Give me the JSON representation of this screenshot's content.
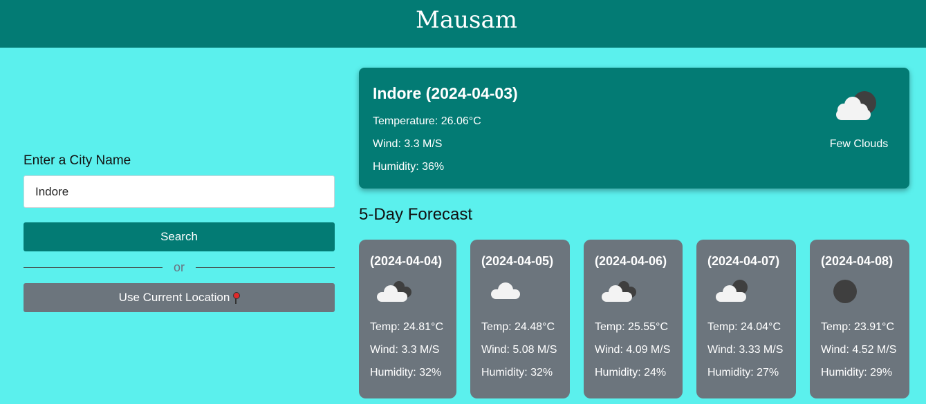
{
  "app": {
    "title": "Mausam"
  },
  "search": {
    "label": "Enter a City Name",
    "value": "Indore",
    "search_button": "Search",
    "divider_text": "or",
    "location_button": "Use Current Location",
    "location_icon": "round-pushpin-icon"
  },
  "current": {
    "title": "Indore (2024-04-03)",
    "temperature": "Temperature: 26.06°C",
    "wind": "Wind: 3.3 M/S",
    "humidity": "Humidity: 36%",
    "condition": "Few Clouds",
    "icon": "few-clouds-icon"
  },
  "forecast": {
    "heading": "5-Day Forecast",
    "days": [
      {
        "date": "(2024-04-04)",
        "temp": "Temp: 24.81°C",
        "wind": "Wind: 3.3 M/S",
        "humidity": "Humidity: 32%",
        "icon": "broken-clouds-icon"
      },
      {
        "date": "(2024-04-05)",
        "temp": "Temp: 24.48°C",
        "wind": "Wind: 5.08 M/S",
        "humidity": "Humidity: 32%",
        "icon": "scattered-clouds-icon"
      },
      {
        "date": "(2024-04-06)",
        "temp": "Temp: 25.55°C",
        "wind": "Wind: 4.09 M/S",
        "humidity": "Humidity: 24%",
        "icon": "broken-clouds-icon"
      },
      {
        "date": "(2024-04-07)",
        "temp": "Temp: 24.04°C",
        "wind": "Wind: 3.33 M/S",
        "humidity": "Humidity: 27%",
        "icon": "few-clouds-icon"
      },
      {
        "date": "(2024-04-08)",
        "temp": "Temp: 23.91°C",
        "wind": "Wind: 4.52 M/S",
        "humidity": "Humidity: 29%",
        "icon": "clear-sky-icon"
      }
    ]
  },
  "colors": {
    "background": "#5bf0ed",
    "primary": "#037b74",
    "secondary": "#6c757d"
  }
}
